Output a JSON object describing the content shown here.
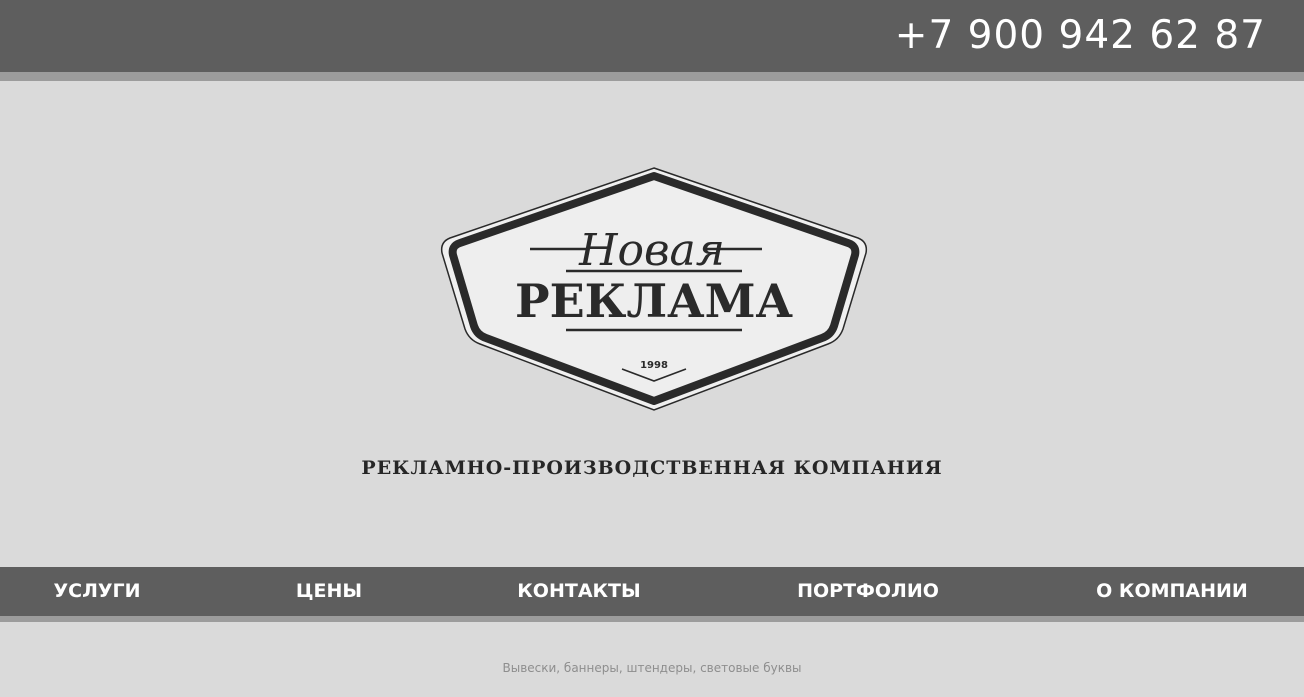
{
  "header": {
    "phone": "+7 900 942 62 87"
  },
  "logo": {
    "script_text": "Новая",
    "main_text": "РЕКЛАМА",
    "year": "1998"
  },
  "tagline": "РЕКЛАМНО-ПРОИЗВОДСТВЕННАЯ КОМПАНИЯ",
  "nav": {
    "items": [
      {
        "label": "УСЛУГИ"
      },
      {
        "label": "ЦЕНЫ"
      },
      {
        "label": "КОНТАКТЫ"
      },
      {
        "label": "ПОРТФОЛИО"
      },
      {
        "label": "О КОМПАНИИ"
      }
    ]
  },
  "footer": {
    "text": "Вывески, баннеры, штендеры, световые буквы"
  },
  "colors": {
    "bar": "#5e5e5e",
    "stripe": "#9c9c9c",
    "background": "#dadada",
    "logo_fill": "#eeeeee",
    "logo_dark": "#2a2a2a"
  }
}
